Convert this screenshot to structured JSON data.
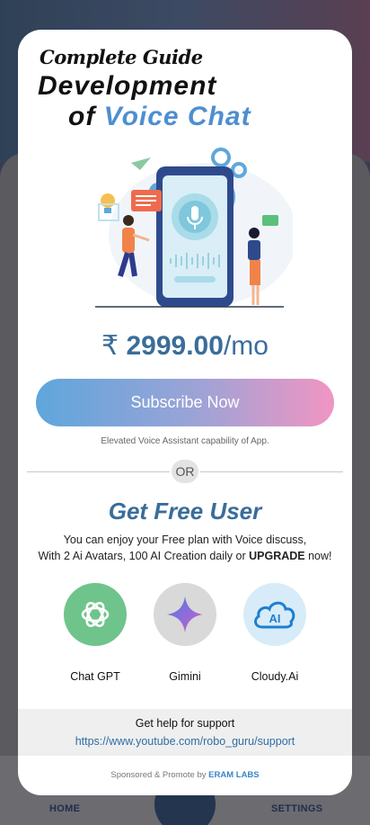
{
  "background": {
    "nav": {
      "home_label": "HOME",
      "settings_label": "SETTINGS"
    }
  },
  "modal": {
    "heading_small": "Complete Guide",
    "heading_line1": "Development",
    "heading_of": "of",
    "heading_accent": "Voice Chat",
    "price": {
      "currency": "₹",
      "amount": "2999.00",
      "period": "/mo"
    },
    "subscribe_label": "Subscribe Now",
    "subscribe_caption": "Elevated Voice Assistant capability of App.",
    "divider_label": "OR",
    "free_title": "Get Free User",
    "free_desc_line1": "You can enjoy your Free plan with Voice discuss,",
    "free_desc_line2_prefix": "With 2 Ai Avatars, 100 AI Creation daily or ",
    "free_desc_upgrade": "UPGRADE",
    "free_desc_line2_suffix": " now!",
    "options": [
      {
        "label": "Chat GPT",
        "icon": "openai-logo-icon",
        "bg": "#6fc48c"
      },
      {
        "label": "Gimini",
        "icon": "gemini-sparkle-icon",
        "bg": "#d9d9d9"
      },
      {
        "label": "Cloudy.Ai",
        "icon": "cloud-ai-icon",
        "bg": "#d7ecf8"
      }
    ],
    "support": {
      "help_text": "Get help for support",
      "link": "https://www.youtube.com/robo_guru/support"
    },
    "sponsored_prefix": "Sponsored & Promote by ",
    "sponsored_brand": "ERAM LABS"
  },
  "colors": {
    "accent_blue": "#3a6d9a",
    "link_blue": "#2f6ea5",
    "gradient_start": "#5ea6dc",
    "gradient_end": "#f195c2"
  }
}
